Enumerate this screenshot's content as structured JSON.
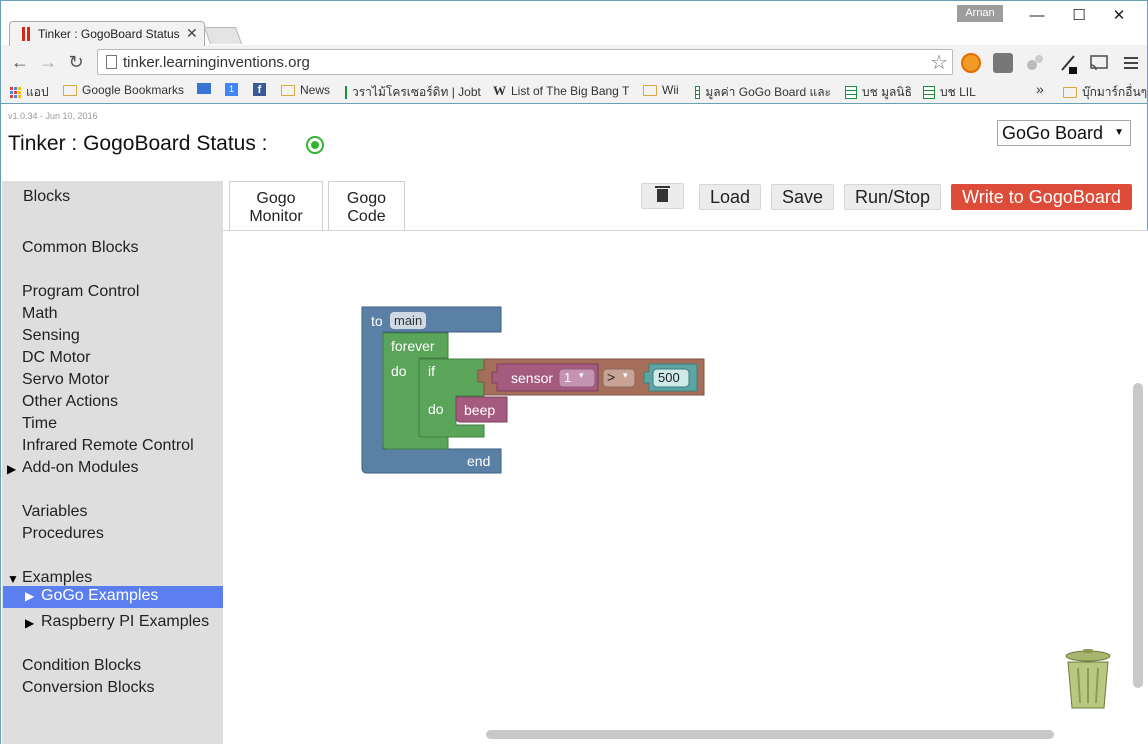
{
  "browser": {
    "tab_title": "Tinker : GogoBoard Status",
    "tab_close": "✕",
    "profile_name": "Arnan",
    "window_controls": {
      "minimize": "—",
      "maximize": "☐",
      "close": "✕"
    },
    "nav": {
      "back": "←",
      "forward": "→",
      "reload": "↻"
    },
    "url": "tinker.learninginventions.org",
    "bookmark_star": "☆",
    "bookmarks": [
      {
        "label": "แอป",
        "icon": "apps-icon"
      },
      {
        "label": "Google Bookmarks",
        "icon": "folder-icon"
      },
      {
        "label": "",
        "icon": "mail-icon"
      },
      {
        "label": "",
        "icon": "calendar-icon"
      },
      {
        "label": "",
        "icon": "facebook-icon"
      },
      {
        "label": "News",
        "icon": "folder-icon"
      },
      {
        "label": "วราไม้โครเซอร์ดิท | Jobtr",
        "icon": "sheet-icon"
      },
      {
        "label": "List of The Big Bang T",
        "icon": "wikipedia-icon"
      },
      {
        "label": "Wii",
        "icon": "folder-icon"
      },
      {
        "label": "มูลค่า GoGo Board และ",
        "icon": "sheet-icon"
      },
      {
        "label": "บช มูลนิธิ",
        "icon": "sheet-icon"
      },
      {
        "label": "บช LIL",
        "icon": "sheet-icon"
      },
      {
        "label": "»",
        "icon": ""
      },
      {
        "label": "บุ๊กมาร์กอื่นๆ",
        "icon": "folder-icon"
      }
    ],
    "calendar_day": "1",
    "facebook_letter": "f",
    "wikipedia_letter": "W"
  },
  "app": {
    "version": "v1.0.34 - Jun 10, 2016",
    "title": "Tinker : GogoBoard Status :",
    "board_select": "GoGo Board",
    "select_caret": "▼",
    "tabs": [
      {
        "label": "Gogo Monitor"
      },
      {
        "label": "Gogo Code"
      }
    ],
    "toolbar": {
      "load": "Load",
      "save": "Save",
      "run_stop": "Run/Stop",
      "write": "Write to GogoBoard"
    },
    "colors": {
      "status": "#2fb52f",
      "write_button": "#dd4b39",
      "selected_item": "#5b7ff1",
      "procedure_block": "#5b80a5",
      "control_block": "#5ba55b",
      "sensor_block": "#a55b80",
      "logic_block": "#a56e5b",
      "number_block": "#5ba5a5"
    }
  },
  "sidebar": {
    "header": "Blocks",
    "items": [
      {
        "label": "Common Blocks"
      },
      {
        "label": "Program Control"
      },
      {
        "label": "Math"
      },
      {
        "label": "Sensing"
      },
      {
        "label": "DC Motor"
      },
      {
        "label": "Servo Motor"
      },
      {
        "label": "Other Actions"
      },
      {
        "label": "Time"
      },
      {
        "label": "Infrared Remote Control"
      },
      {
        "label": "Add-on Modules",
        "arrow": "▶"
      },
      {
        "label": "Variables"
      },
      {
        "label": "Procedures"
      },
      {
        "label": "Examples",
        "arrow": "▼"
      },
      {
        "label": "GoGo Examples",
        "arrow": "▶",
        "selected": true
      },
      {
        "label": "Raspberry PI Examples",
        "arrow": "▶"
      },
      {
        "label": "Condition Blocks"
      },
      {
        "label": "Conversion Blocks"
      }
    ]
  },
  "blocks": {
    "proc_to": "to",
    "proc_name": "main",
    "proc_end": "end",
    "forever": "forever",
    "forever_do": "do",
    "if": "if",
    "if_do": "do",
    "sensor": "sensor",
    "sensor_port": "1",
    "operator": ">",
    "dropdown_arrow": "▾",
    "threshold": "500",
    "beep": "beep"
  }
}
